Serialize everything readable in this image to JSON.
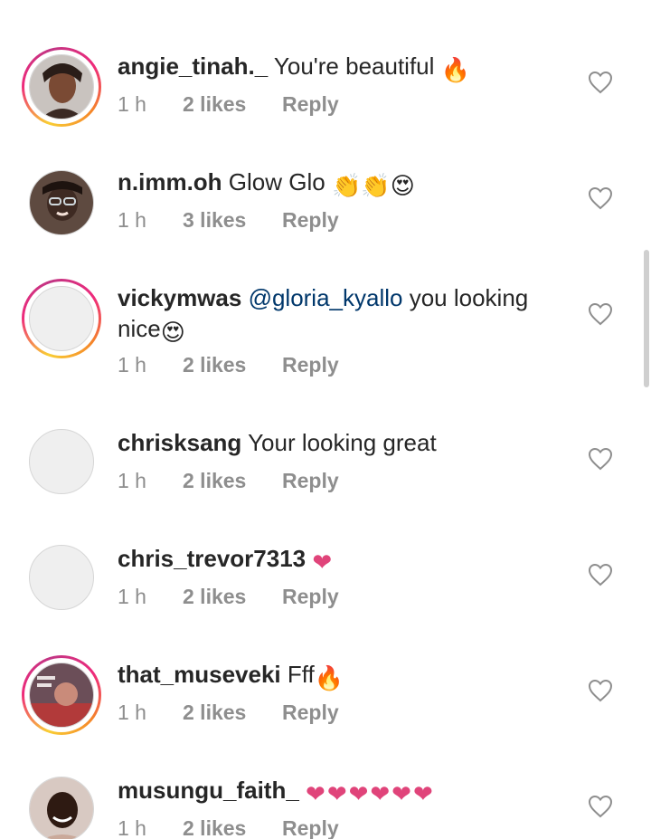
{
  "comments": [
    {
      "username": "angie_tinah._",
      "text": "You're beautiful",
      "emoji": "🔥",
      "time": "1 h",
      "likes": "2 likes",
      "reply": "Reply",
      "avatar": "photo",
      "ring": true
    },
    {
      "username": "n.imm.oh",
      "text": "Glow Glo",
      "emoji": "👏👏😍",
      "time": "1 h",
      "likes": "3 likes",
      "reply": "Reply",
      "avatar": "photo",
      "ring": false
    },
    {
      "username": "vickymwas",
      "mention": "@gloria_kyallo",
      "text": "you looking nice",
      "emoji": "😍",
      "time": "1 h",
      "likes": "2 likes",
      "reply": "Reply",
      "avatar": "blank",
      "ring": true
    },
    {
      "username": "chrisksang",
      "text": "Your looking great",
      "emoji": "",
      "time": "1 h",
      "likes": "2 likes",
      "reply": "Reply",
      "avatar": "blank",
      "ring": false
    },
    {
      "username": "chris_trevor7313",
      "text": "",
      "emoji": "❤",
      "time": "1 h",
      "likes": "2 likes",
      "reply": "Reply",
      "avatar": "blank",
      "ring": false
    },
    {
      "username": "that_museveki",
      "text": "Fff",
      "emoji": "🔥",
      "time": "1 h",
      "likes": "2 likes",
      "reply": "Reply",
      "avatar": "photo",
      "ring": true
    },
    {
      "username": "musungu_faith_",
      "text": "",
      "emoji": "❤❤❤❤❤❤",
      "time": "1 h",
      "likes": "2 likes",
      "reply": "Reply",
      "avatar": "photo",
      "ring": false
    }
  ],
  "colors": {
    "username": "#262626",
    "meta": "#8e8e8e",
    "mention": "#00376b",
    "heart_emoji": "#e0447a"
  },
  "icons": {
    "like": "heart-outline-icon"
  }
}
